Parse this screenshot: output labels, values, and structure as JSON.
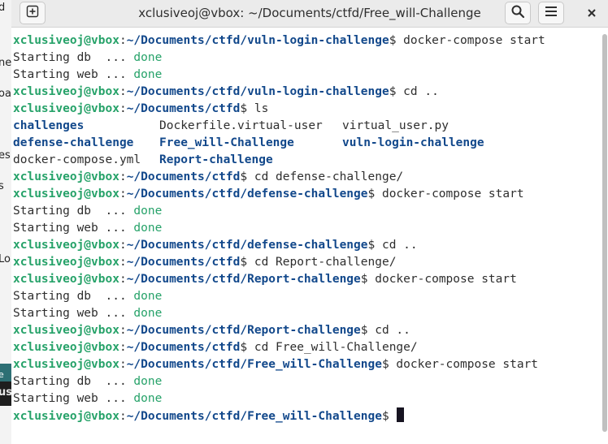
{
  "window": {
    "title": "xclusiveoj@vbox: ~/Documents/ctfd/Free_will-Challenge",
    "new_tab_icon": "plus-icon",
    "search_icon": "search-icon",
    "menu_icon": "hamburger-menu-icon",
    "close_icon": "close-icon"
  },
  "background": {
    "fragments": [
      "d",
      "ne",
      "oa",
      "es",
      "s",
      "Lo",
      "e",
      "us"
    ]
  },
  "prompt": {
    "user": "xclusiveoj@vbox",
    "sep": ":",
    "dollar": "$"
  },
  "terminal": {
    "lines": [
      {
        "type": "prompt",
        "path": "~/Documents/ctfd/vuln-login-challenge",
        "cmd": " docker-compose start"
      },
      {
        "type": "status",
        "label": "Starting db  ... ",
        "status": "done"
      },
      {
        "type": "status",
        "label": "Starting web ... ",
        "status": "done"
      },
      {
        "type": "prompt",
        "path": "~/Documents/ctfd/vuln-login-challenge",
        "cmd": " cd .."
      },
      {
        "type": "prompt",
        "path": "~/Documents/ctfd",
        "cmd": " ls"
      },
      {
        "type": "ls",
        "cols": [
          {
            "text": "challenges",
            "dir": true
          },
          {
            "text": "Dockerfile.virtual-user",
            "dir": false
          },
          {
            "text": "virtual_user.py",
            "dir": false
          }
        ]
      },
      {
        "type": "ls",
        "cols": [
          {
            "text": "defense-challenge",
            "dir": true
          },
          {
            "text": "Free_will-Challenge",
            "dir": true
          },
          {
            "text": "vuln-login-challenge",
            "dir": true
          }
        ]
      },
      {
        "type": "ls",
        "cols": [
          {
            "text": "docker-compose.yml",
            "dir": false
          },
          {
            "text": "Report-challenge",
            "dir": true
          },
          {
            "text": "",
            "dir": false
          }
        ]
      },
      {
        "type": "prompt",
        "path": "~/Documents/ctfd",
        "cmd": " cd defense-challenge/"
      },
      {
        "type": "prompt",
        "path": "~/Documents/ctfd/defense-challenge",
        "cmd": " docker-compose start"
      },
      {
        "type": "status",
        "label": "Starting db  ... ",
        "status": "done"
      },
      {
        "type": "status",
        "label": "Starting web ... ",
        "status": "done"
      },
      {
        "type": "prompt",
        "path": "~/Documents/ctfd/defense-challenge",
        "cmd": " cd .."
      },
      {
        "type": "prompt",
        "path": "~/Documents/ctfd",
        "cmd": " cd Report-challenge/"
      },
      {
        "type": "prompt",
        "path": "~/Documents/ctfd/Report-challenge",
        "cmd": " docker-compose start"
      },
      {
        "type": "status",
        "label": "Starting db  ... ",
        "status": "done"
      },
      {
        "type": "status",
        "label": "Starting web ... ",
        "status": "done"
      },
      {
        "type": "prompt",
        "path": "~/Documents/ctfd/Report-challenge",
        "cmd": " cd .."
      },
      {
        "type": "prompt",
        "path": "~/Documents/ctfd",
        "cmd": " cd Free_will-Challenge/"
      },
      {
        "type": "prompt",
        "path": "~/Documents/ctfd/Free_will-Challenge",
        "cmd": " docker-compose start"
      },
      {
        "type": "status",
        "label": "Starting db  ... ",
        "status": "done"
      },
      {
        "type": "status",
        "label": "Starting web ... ",
        "status": "done"
      },
      {
        "type": "prompt",
        "path": "~/Documents/ctfd/Free_will-Challenge",
        "cmd": " ",
        "cursor": true
      }
    ]
  },
  "colors": {
    "user": "#26a269",
    "path": "#12488b",
    "done": "#26a269",
    "text": "#2e2e2e",
    "titlebar": "#ebebeb"
  }
}
